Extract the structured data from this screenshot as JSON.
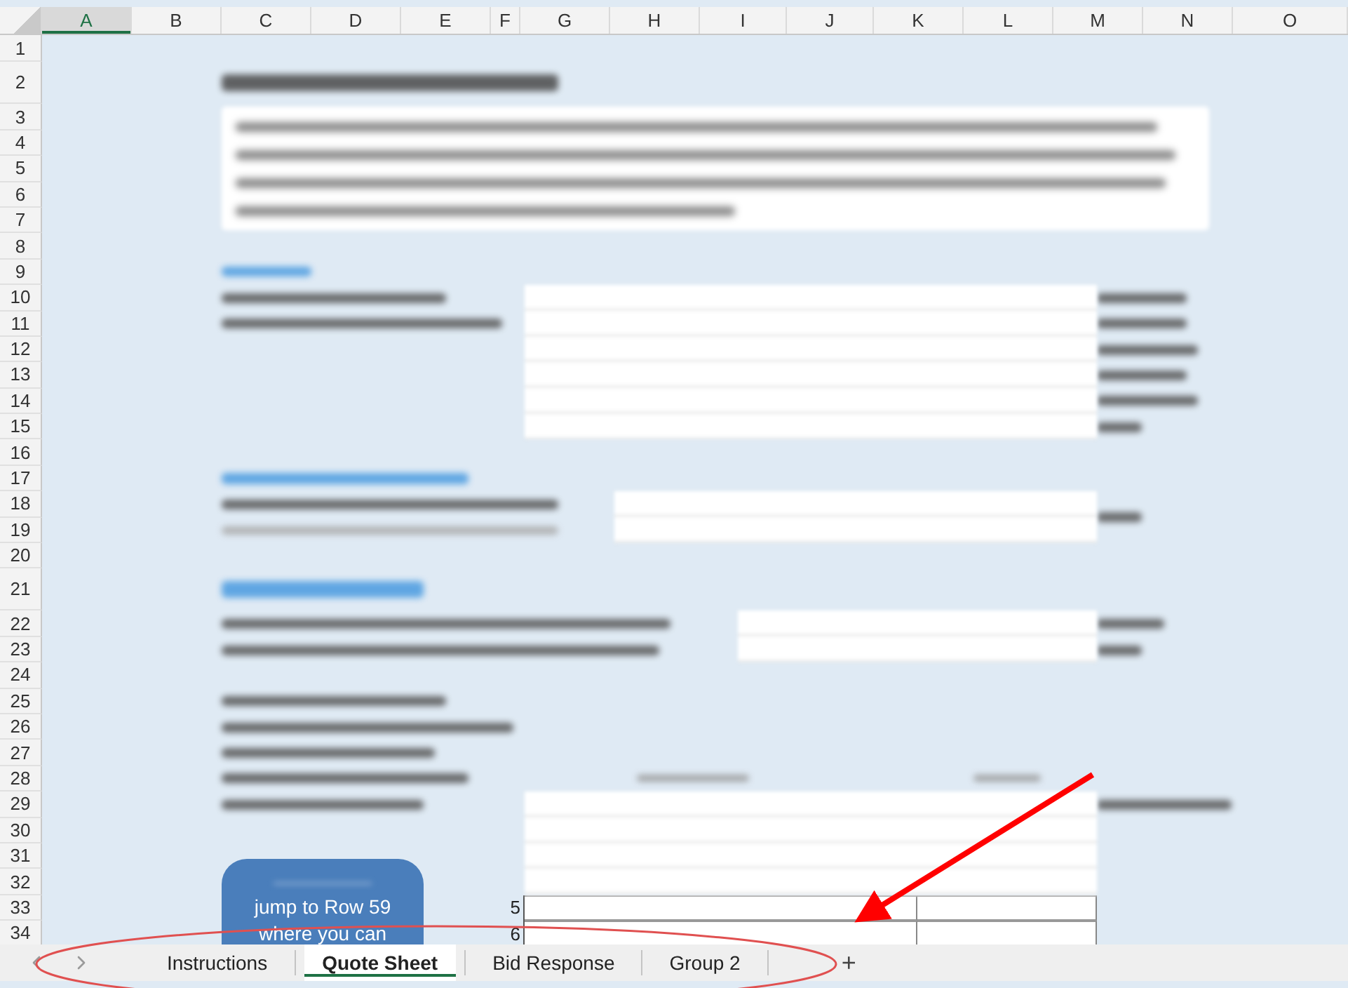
{
  "columns": [
    {
      "label": "A",
      "selected": true
    },
    {
      "label": "B",
      "selected": false
    },
    {
      "label": "C",
      "selected": false
    },
    {
      "label": "D",
      "selected": false
    },
    {
      "label": "E",
      "selected": false
    },
    {
      "label": "F",
      "selected": false
    },
    {
      "label": "G",
      "selected": false
    },
    {
      "label": "H",
      "selected": false
    },
    {
      "label": "I",
      "selected": false
    },
    {
      "label": "J",
      "selected": false
    },
    {
      "label": "K",
      "selected": false
    },
    {
      "label": "L",
      "selected": false
    },
    {
      "label": "M",
      "selected": false
    },
    {
      "label": "N",
      "selected": false
    },
    {
      "label": "O",
      "selected": false
    }
  ],
  "rows": [
    "1",
    "2",
    "3",
    "4",
    "5",
    "6",
    "7",
    "8",
    "9",
    "10",
    "11",
    "12",
    "13",
    "14",
    "15",
    "16",
    "17",
    "18",
    "19",
    "20",
    "21",
    "22",
    "23",
    "24",
    "25",
    "26",
    "27",
    "28",
    "29",
    "30",
    "31",
    "32",
    "33",
    "34"
  ],
  "jump_button": {
    "lines": [
      "jump to Row 59",
      "where you can"
    ]
  },
  "offer_table": {
    "rows": [
      {
        "index": "5"
      },
      {
        "index": "6"
      }
    ]
  },
  "sheet_tabs": [
    {
      "label": "Instructions",
      "selected": false
    },
    {
      "label": "Quote Sheet",
      "selected": true
    },
    {
      "label": "Bid Response",
      "selected": false
    },
    {
      "label": "Group 2",
      "selected": false
    }
  ],
  "add_sheet": "+"
}
